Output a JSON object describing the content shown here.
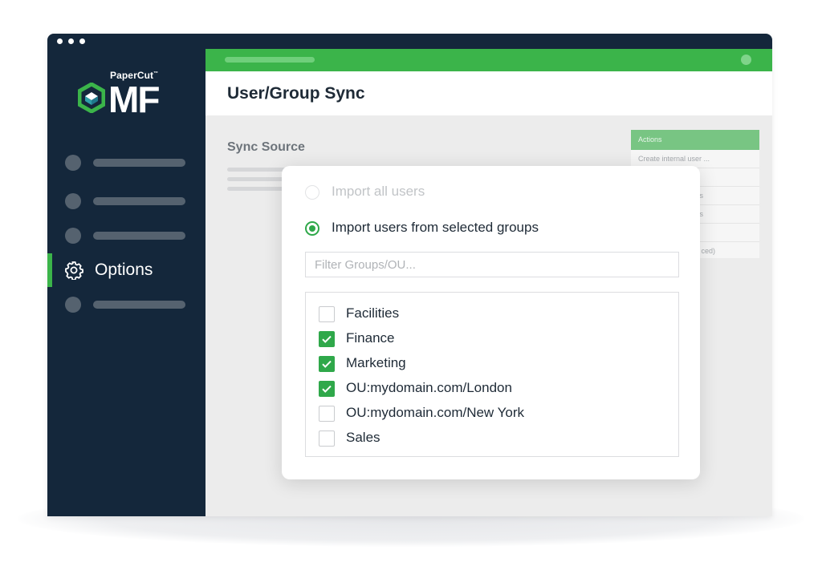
{
  "brand": {
    "small_text": "PaperCut",
    "trademark": "™",
    "product": "MF"
  },
  "sidebar": {
    "items": [
      {
        "type": "placeholder"
      },
      {
        "type": "placeholder"
      },
      {
        "type": "placeholder"
      },
      {
        "type": "active",
        "label": "Options",
        "icon": "gear-icon"
      },
      {
        "type": "placeholder"
      }
    ]
  },
  "page": {
    "title": "User/Group Sync",
    "section_title": "Sync Source"
  },
  "actions_panel": {
    "header": "Actions",
    "items": [
      "Create internal user ...",
      "",
      "s",
      "s",
      "",
      "ced)"
    ]
  },
  "modal": {
    "radio_options": [
      {
        "label": "Import all users",
        "selected": false
      },
      {
        "label": "Import users from selected groups",
        "selected": true
      }
    ],
    "filter": {
      "placeholder": "Filter Groups/OU...",
      "value": ""
    },
    "groups": [
      {
        "label": "Facilities",
        "checked": false
      },
      {
        "label": "Finance",
        "checked": true
      },
      {
        "label": "Marketing",
        "checked": true
      },
      {
        "label": "OU:mydomain.com/London",
        "checked": true
      },
      {
        "label": "OU:mydomain.com/New York",
        "checked": false
      },
      {
        "label": "Sales",
        "checked": false
      }
    ]
  },
  "colors": {
    "sidebar_bg": "#14273b",
    "accent_green": "#3bb44a",
    "checkbox_green": "#2fa84a",
    "content_bg": "#ececec"
  }
}
